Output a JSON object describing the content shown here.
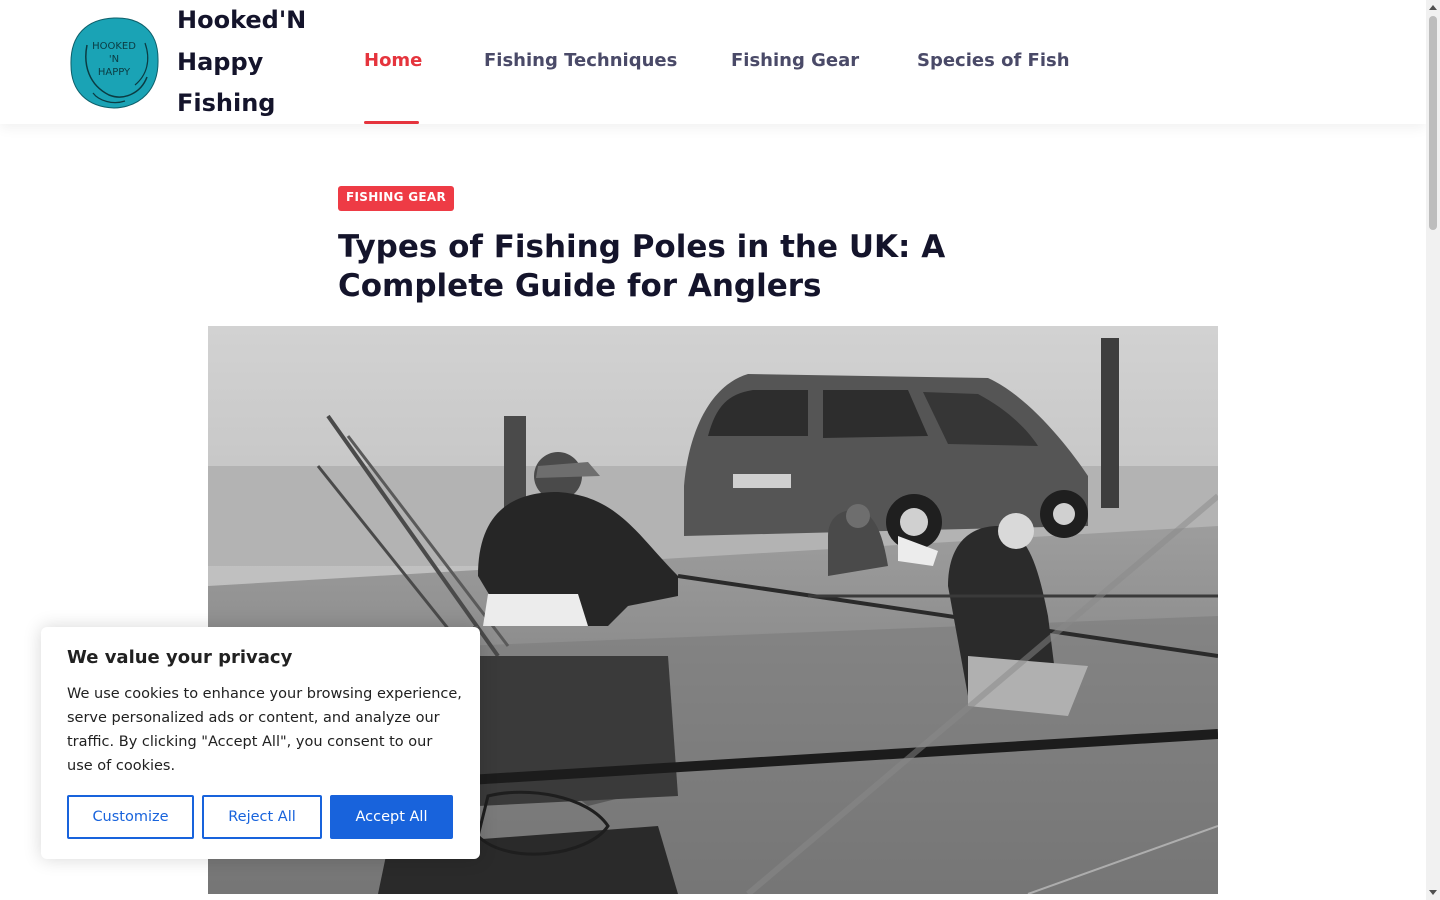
{
  "header": {
    "site_title": "Hooked'N Happy Fishing",
    "logo_text": [
      "HOOKED",
      "'N",
      "HAPPY"
    ],
    "logo_color": "#1aa3b5"
  },
  "nav": {
    "items": [
      {
        "label": "Home",
        "active": true
      },
      {
        "label": "Fishing Techniques",
        "active": false
      },
      {
        "label": "Fishing Gear",
        "active": false
      },
      {
        "label": "Species of Fish",
        "active": false
      }
    ],
    "active_color": "#e5343d"
  },
  "article": {
    "category": "Fishing Gear",
    "title": "Types of Fishing Poles in the UK: A Complete Guide for Anglers",
    "hero_image": "anglers-pole-fishing-photo"
  },
  "cookie_banner": {
    "title": "We value your privacy",
    "text": "We use cookies to enhance your browsing experience, serve personalized ads or content, and analyze our traffic. By clicking \"Accept All\", you consent to our use of cookies.",
    "buttons": {
      "customize": "Customize",
      "reject": "Reject All",
      "accept": "Accept All"
    },
    "accent_color": "#1863dc"
  }
}
